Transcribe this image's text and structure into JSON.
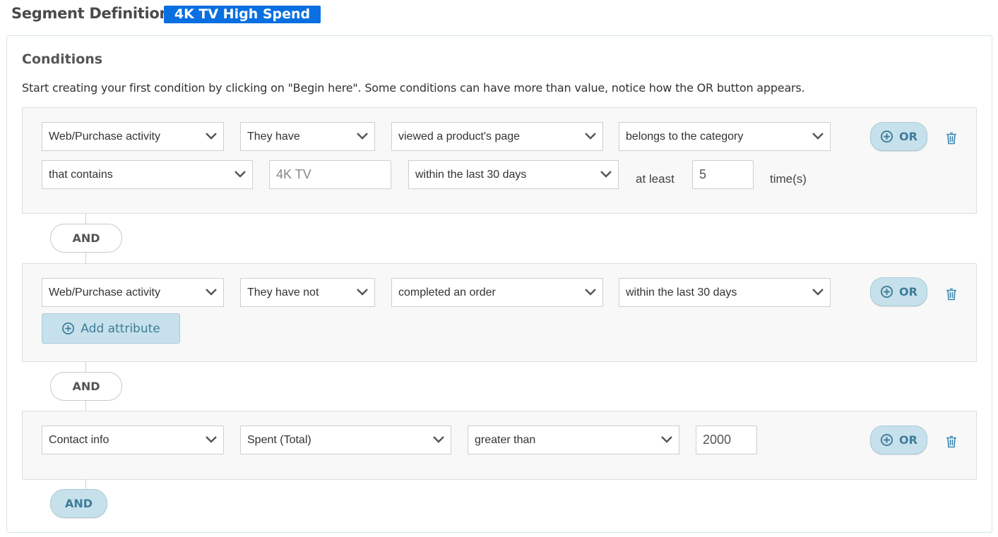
{
  "header": {
    "title": "Segment Definition",
    "segment_name": "4K TV High Spend",
    "segment_name_color": "#0a6fe0"
  },
  "conditions": {
    "title": "Conditions",
    "help_text": "Start creating your first condition by clicking on \"Begin here\". Some conditions can have more than value, notice how the OR button appears."
  },
  "group1": {
    "source": "Web/Purchase activity",
    "qualifier": "They have",
    "action": "viewed a product's page",
    "attribute": "belongs to the category",
    "operator": "that contains",
    "value_placeholder": "4K TV",
    "timeframe": "within the last 30 days",
    "at_least_label": "at least",
    "count": "5",
    "times_label": "time(s)",
    "or_label": "OR"
  },
  "group2": {
    "source": "Web/Purchase activity",
    "qualifier": "They have not",
    "action": "completed an order",
    "timeframe": "within the last 30 days",
    "add_attribute_label": "Add attribute",
    "or_label": "OR"
  },
  "group3": {
    "source": "Contact info",
    "field": "Spent (Total)",
    "operator": "greater than",
    "value": "2000",
    "or_label": "OR"
  },
  "connectors": {
    "and_label": "AND"
  },
  "icons": {
    "chevron": "chevron-down-icon",
    "plus_circle": "plus-circle-icon",
    "trash": "trash-icon"
  },
  "colors": {
    "accent_bg": "#c6e1ec",
    "accent_text": "#3e7c97"
  }
}
